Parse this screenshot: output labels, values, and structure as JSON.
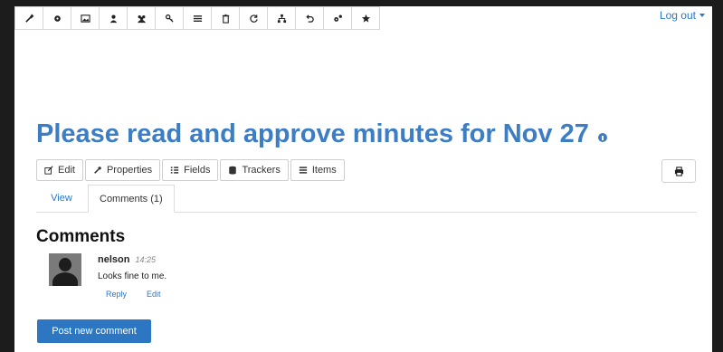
{
  "toolbar": {
    "icons": [
      "wrench-icon",
      "gear-icon",
      "image-icon",
      "user-icon",
      "group-icon",
      "key-icon",
      "list-icon",
      "trash-icon",
      "refresh-icon",
      "sitemap-icon",
      "undo-icon",
      "settings-icon",
      "star-icon"
    ]
  },
  "header": {
    "logout_label": "Log out"
  },
  "page": {
    "title": "Please read and approve minutes for Nov 27"
  },
  "actions": [
    {
      "label": "Edit",
      "icon": "edit-icon"
    },
    {
      "label": "Properties",
      "icon": "wrench-icon"
    },
    {
      "label": "Fields",
      "icon": "fields-icon"
    },
    {
      "label": "Trackers",
      "icon": "database-icon"
    },
    {
      "label": "Items",
      "icon": "list-icon"
    }
  ],
  "tabs": [
    {
      "label": "View",
      "active": false
    },
    {
      "label": "Comments (1)",
      "active": true
    }
  ],
  "comments": {
    "heading": "Comments",
    "items": [
      {
        "author": "nelson",
        "time": "14:25",
        "text": "Looks fine to me.",
        "reply_label": "Reply",
        "edit_label": "Edit"
      }
    ]
  },
  "post_button_label": "Post new comment",
  "colors": {
    "link": "#2d77c2",
    "title": "#3c7dc4",
    "primary_button": "#2d77c2"
  }
}
